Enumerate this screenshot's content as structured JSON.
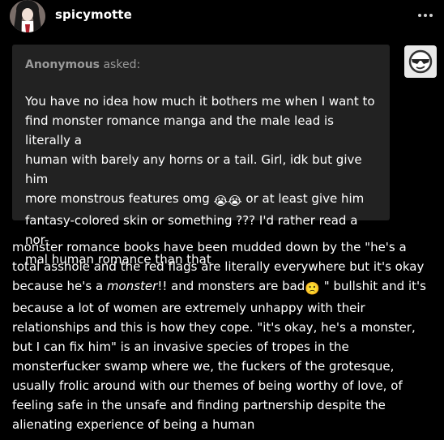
{
  "header": {
    "username": "spicymotte",
    "avatar_icon": "user-avatar-icon",
    "more_icon": "more-dots-icon"
  },
  "ask": {
    "asker_name": "Anonymous",
    "asker_suffix": " asked:",
    "avatar_icon": "anonymous-sunglasses-icon",
    "question_lines": [
      "You have no idea how much it bothers me when I want to",
      "find monster romance manga and the male lead is literally a",
      "human with barely any horns or a tail. Girl, idk but give him",
      "more monstrous features omg",
      " or at least give him",
      "fantasy-colored skin or something ??? I'd rather read a nor-",
      "mal human romance than that"
    ],
    "crying_emoji": "😭"
  },
  "answer": {
    "part1": "monster romance books have been mudded down by the \"he's a total asshole and the red flags are literally everywhere but it's okay because he's a ",
    "italic": "monster",
    "part2": "!! and monsters are bad",
    "emoji": "🙁",
    "part3": " \" bullshit and it's because a lot of women are extremely unhappy with their relationships and this is how they cope. \"it's okay, he's a monster, but I can fix him\" is an invasive species of tropes in the monsterfucker swamp where we, the fuckers of the grotesque, usually frolic around with our themes of being worthy of love, of feeling safe in the unsafe and finding partnership despite the alienating experience of being a human"
  },
  "colors": {
    "background": "#000000",
    "ask_box": "#222222",
    "asker_text": "#9a9a9a",
    "text": "#ffffff"
  }
}
